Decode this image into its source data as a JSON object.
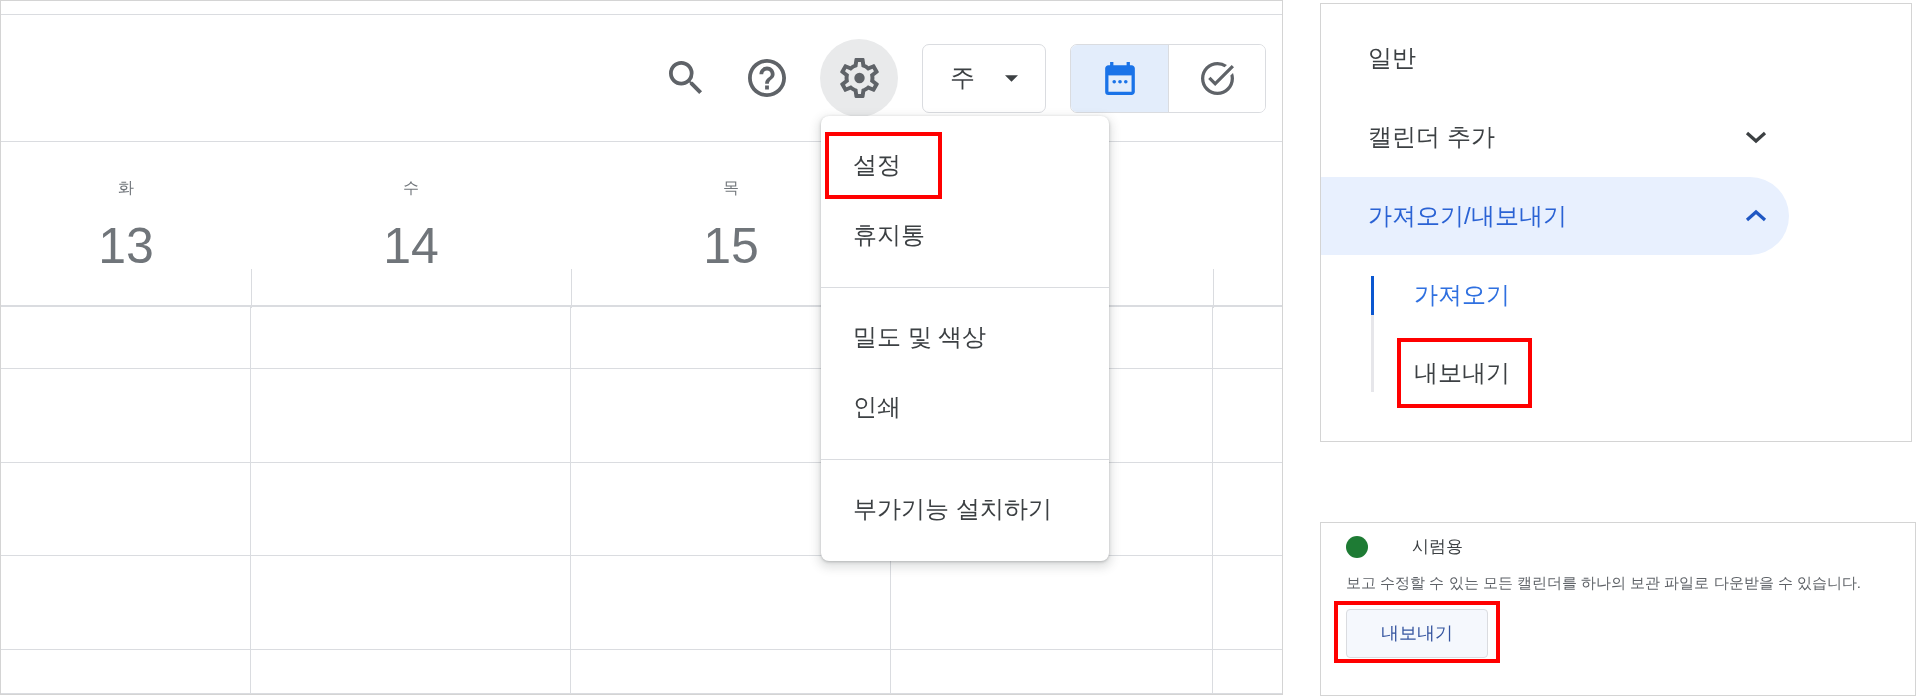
{
  "calendar": {
    "toolbar": {
      "settings_button": {
        "active": true
      },
      "view_dropdown": {
        "label": "주"
      },
      "view_toggle": [
        {
          "kind": "calendar",
          "selected": true
        },
        {
          "kind": "tasks",
          "selected": false
        }
      ]
    },
    "days": [
      {
        "weekday": "화",
        "date": "13"
      },
      {
        "weekday": "수",
        "date": "14"
      },
      {
        "weekday": "목",
        "date": "15"
      }
    ],
    "settings_menu": {
      "sections": [
        {
          "items": [
            {
              "label": "설정",
              "highlighted": true
            },
            {
              "label": "휴지통",
              "highlighted": false
            }
          ]
        },
        {
          "items": [
            {
              "label": "밀도 및 색상",
              "highlighted": false
            },
            {
              "label": "인쇄",
              "highlighted": false
            }
          ]
        },
        {
          "items": [
            {
              "label": "부가기능 설치하기",
              "highlighted": false
            }
          ]
        }
      ]
    }
  },
  "settings_nav": {
    "items": [
      {
        "kind": "page",
        "label": "일반",
        "selected": false
      },
      {
        "kind": "section",
        "label": "캘린더 추가",
        "selected": false,
        "expanded": false
      },
      {
        "kind": "section",
        "label": "가져오기/내보내기",
        "selected": true,
        "expanded": true,
        "children": [
          {
            "label": "가져오기",
            "selected": true,
            "highlighted": false
          },
          {
            "label": "내보내기",
            "selected": false,
            "highlighted": true
          }
        ]
      }
    ]
  },
  "export_panel": {
    "calendar": {
      "name": "시럼용",
      "color": "#1e7b34"
    },
    "description": "보고 수정할 수 있는 모든 캘린더를 하나의 보관 파일로 다운받을 수 있습니다.",
    "export_button": {
      "label": "내보내기",
      "highlighted": true
    }
  }
}
